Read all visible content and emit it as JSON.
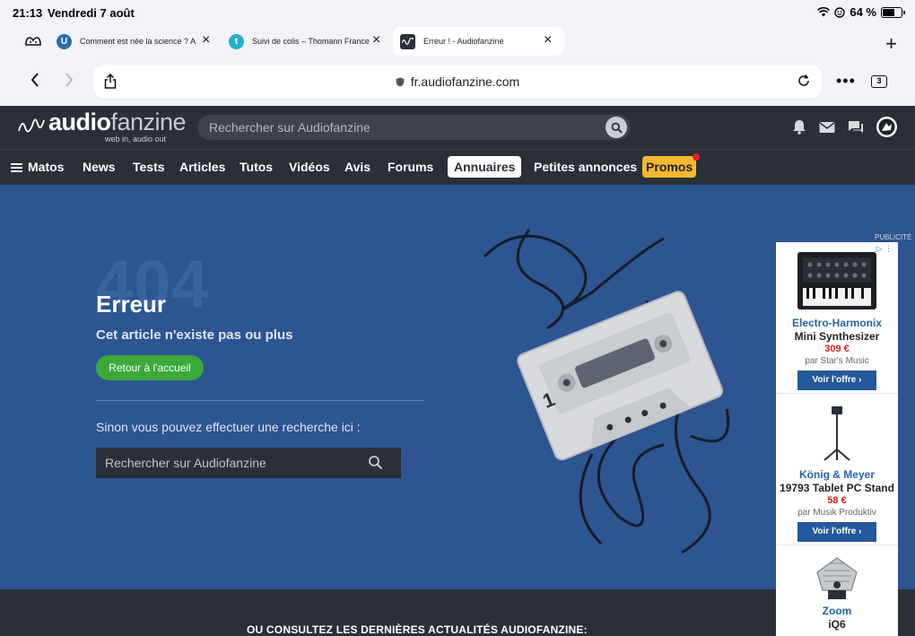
{
  "status_bar": {
    "time": "21:13",
    "date": "Vendredi 7 août",
    "battery": "64 %",
    "battery_fraction": 0.64
  },
  "tabs": [
    {
      "title": "Comment est née la science ? A",
      "favicon": "U",
      "color": "#2e6ca8"
    },
    {
      "title": "Suivi de colis – Thomann France",
      "favicon": "t",
      "color": "#1fb1c7"
    },
    {
      "title": "Erreur ! - Audiofanzine",
      "favicon": "wave",
      "color": "#2b2f38"
    }
  ],
  "address_bar": {
    "domain": "fr.audiofanzine.com",
    "tab_count": "3"
  },
  "site": {
    "logo_text_bold": "audio",
    "logo_text_light": "fanzine",
    "tagline": "web in, audio out",
    "search_placeholder": "Rechercher sur Audiofanzine"
  },
  "nav": {
    "menu_label": "Matos",
    "items": [
      "News",
      "Tests",
      "Articles",
      "Tutos",
      "Vidéos",
      "Avis",
      "Forums",
      "Annuaires",
      "Petites annonces",
      "Promos"
    ]
  },
  "error_page": {
    "code": "404",
    "title": "Erreur",
    "subtitle": "Cet article n'existe pas ou plus",
    "home_button": "Retour à l'accueil",
    "search_prompt": "Sinon vous pouvez effectuer une recherche ici :",
    "search_placeholder": "Rechercher sur Audiofanzine"
  },
  "news_heading": "OU CONSULTEZ LES DERNIÈRES ACTUALITÉS AUDIOFANZINE:",
  "ad": {
    "label": "PUBLICITÉ",
    "items": [
      {
        "brand": "Electro-Harmonix",
        "product": "Mini Synthesizer",
        "price": "309 €",
        "seller": "par Star's Music",
        "cta": "Voir l'offre"
      },
      {
        "brand": "König & Meyer",
        "product": "19793 Tablet PC Stand",
        "price": "58 €",
        "seller": "par Musik Produktiv",
        "cta": "Voir l'offre"
      },
      {
        "brand": "Zoom",
        "product": "iQ6"
      }
    ]
  },
  "colors": {
    "header_bg": "#2b2f38",
    "hero_bg": "#2c5592",
    "accent_green": "#3aa93a",
    "promo_yellow": "#f5b82e",
    "ad_blue": "#24599a"
  }
}
